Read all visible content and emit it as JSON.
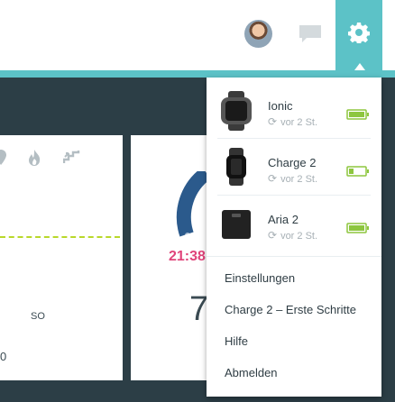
{
  "header": {
    "avatar_icon": "user-avatar",
    "chat_icon": "chat-bubble-icon",
    "settings_icon": "gear-icon",
    "accent_color": "#5cc2c7"
  },
  "background": {
    "tick_label": "SO",
    "axis_zero": "0",
    "time": "21:38",
    "big_number": "7"
  },
  "devices": [
    {
      "name": "Ionic",
      "sync": "vor 2 St.",
      "battery": 1.0,
      "battery_color": "#8dc63f"
    },
    {
      "name": "Charge 2",
      "sync": "vor 2 St.",
      "battery": 0.3,
      "battery_color": "#8dc63f"
    },
    {
      "name": "Aria 2",
      "sync": "vor 2 St.",
      "battery": 1.0,
      "battery_color": "#8dc63f"
    }
  ],
  "menu": {
    "items": [
      "Einstellungen",
      "Charge 2 – Erste Schritte",
      "Hilfe",
      "Abmelden"
    ]
  }
}
